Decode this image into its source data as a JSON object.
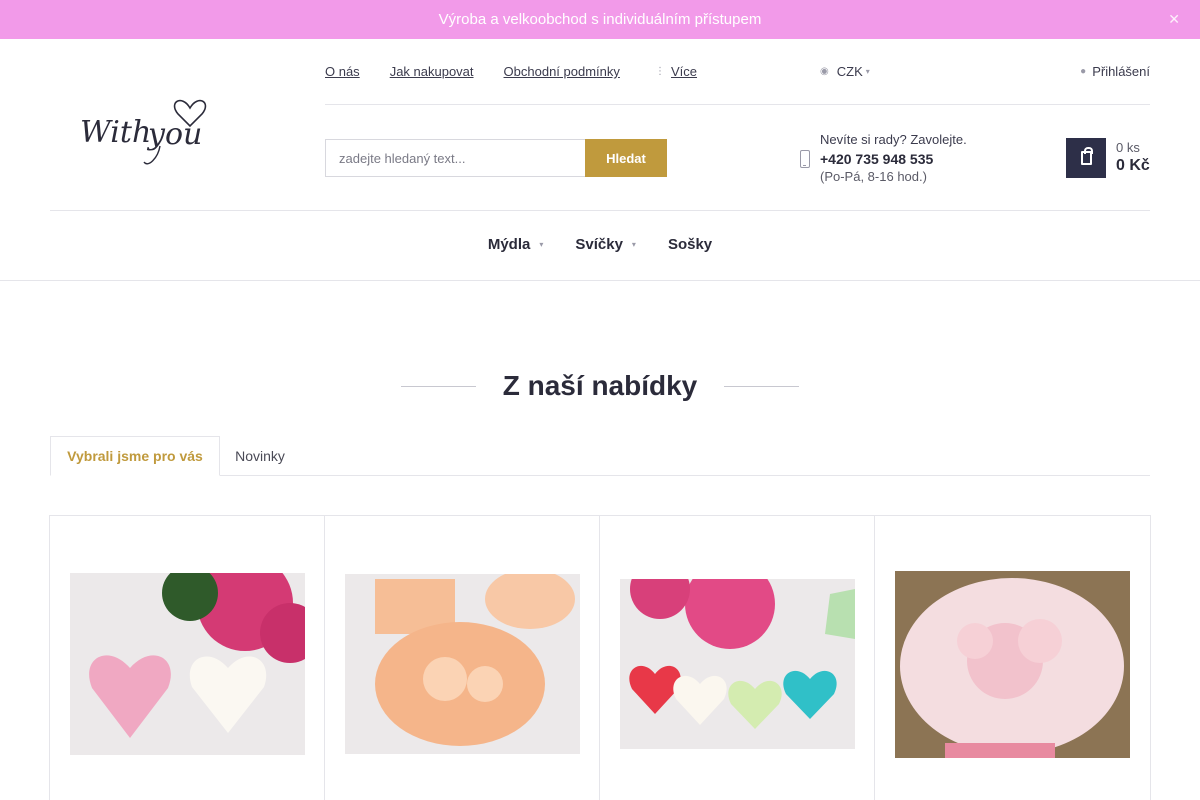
{
  "banner": {
    "text": "Výroba a velkoobchod s individuálním přístupem",
    "close_icon": "close-icon",
    "color": "#f29ae9"
  },
  "logo": {
    "text": "With you"
  },
  "toplinks": [
    "O nás",
    "Jak nakupovat",
    "Obchodní podmínky"
  ],
  "more": {
    "label": "Více",
    "icon": "dots-icon"
  },
  "currency": {
    "label": "CZK",
    "icon": "currency-icon"
  },
  "login": {
    "label": "Přihlášení",
    "icon": "user-icon"
  },
  "search": {
    "placeholder": "zadejte hledaný text...",
    "button": "Hledat"
  },
  "help": {
    "line1": "Nevíte si rady? Zavolejte.",
    "phone": "+420 735 948 535",
    "hours": "(Po-Pá, 8-16 hod.)",
    "icon": "phone-icon"
  },
  "cart": {
    "count": "0 ks",
    "total": "0 Kč",
    "icon": "shopping-bag-icon"
  },
  "nav": {
    "items": [
      "Mýdla",
      "Svíčky",
      "Sošky"
    ]
  },
  "section": {
    "title": "Z naší nabídky"
  },
  "tabs": [
    "Vybrali jsme pro vás",
    "Novinky"
  ],
  "colors": {
    "accent": "#c09a3d",
    "dark": "#2d2f48",
    "banner": "#f29ae9"
  }
}
